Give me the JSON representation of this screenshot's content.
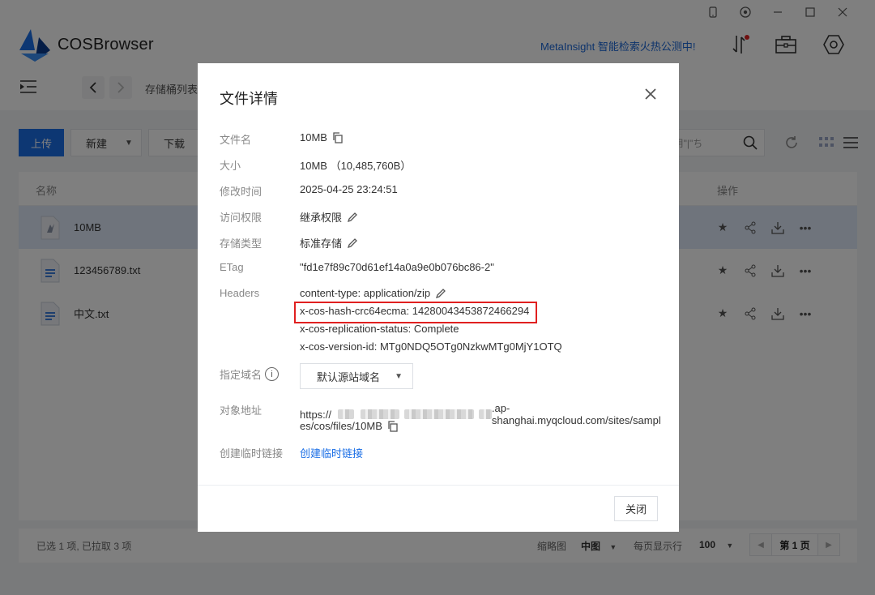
{
  "app": {
    "name": "COSBrowser",
    "promo": "MetaInsight 智能检索火热公测中!",
    "breadcrumb": "存储桶列表"
  },
  "toolbar": {
    "upload": "上传",
    "new": "新建",
    "download": "下载",
    "search_placeholder": "s/ 用\"|\"ち"
  },
  "table": {
    "col_name": "名称",
    "col_actions": "操作",
    "rows": [
      {
        "name": "10MB",
        "selected": true
      },
      {
        "name": "123456789.txt",
        "selected": false
      },
      {
        "name": "中文.txt",
        "selected": false
      }
    ]
  },
  "footer": {
    "status": "已选 1 项, 已拉取 3 项",
    "thumb_label": "缩略图",
    "thumb_value": "中图",
    "per_page_label": "每页显示行",
    "per_page_value": "100",
    "page": "第 1 页"
  },
  "modal": {
    "title": "文件详情",
    "fields": {
      "name_label": "文件名",
      "name_value": "10MB",
      "size_label": "大小",
      "size_value": "10MB （10,485,760B）",
      "mtime_label": "修改时间",
      "mtime_value": "2025-04-25 23:24:51",
      "acl_label": "访问权限",
      "acl_value": "继承权限",
      "storage_label": "存储类型",
      "storage_value": "标准存储",
      "etag_label": "ETag",
      "etag_value": "\"fd1e7f89c70d61ef14a0a9e0b076bc86-2\"",
      "headers_label": "Headers",
      "header_1": "content-type: application/zip",
      "header_2": "x-cos-hash-crc64ecma: 14280043453872466294",
      "header_3": "x-cos-replication-status: Complete",
      "header_4": "x-cos-version-id: MTg0NDQ5OTg0NzkwMTg0MjY1OTQ",
      "domain_label": "指定域名",
      "domain_value": "默认源站域名",
      "url_label": "对象地址",
      "url_prefix": "https://",
      "url_suffix": ".ap-shanghai.myqcloud.com/sites/sampl",
      "url_line2": "es/cos/files/10MB",
      "templink_label": "创建临时链接",
      "templink_value": "创建临时链接"
    },
    "close_button": "关闭"
  }
}
